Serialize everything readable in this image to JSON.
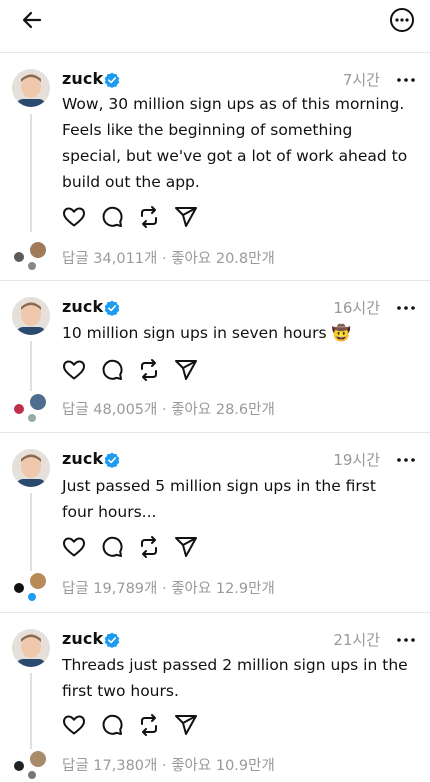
{
  "topbar": {
    "back_icon": "arrow-left-icon",
    "more_icon": "more-circle-icon"
  },
  "posts": [
    {
      "username": "zuck",
      "time": "7시간",
      "text": "Wow, 30 million sign ups as of this morning. Feels like the beginning of something special, but we've got a lot of work ahead to build out the app.",
      "replies_label": "답글",
      "replies": "34,011개",
      "separator": "·",
      "likes_label": "좋아요",
      "likes": "20.8만개"
    },
    {
      "username": "zuck",
      "time": "16시간",
      "text": "10 million sign ups in seven hours 🤠",
      "replies_label": "답글",
      "replies": "48,005개",
      "separator": "·",
      "likes_label": "좋아요",
      "likes": "28.6만개"
    },
    {
      "username": "zuck",
      "time": "19시간",
      "text": "Just passed 5 million sign ups in the first four hours...",
      "replies_label": "답글",
      "replies": "19,789개",
      "separator": "·",
      "likes_label": "좋아요",
      "likes": "12.9만개"
    },
    {
      "username": "zuck",
      "time": "21시간",
      "text": "Threads just passed 2 million sign ups in the first two hours.",
      "replies_label": "답글",
      "replies": "17,380개",
      "separator": "·",
      "likes_label": "좋아요",
      "likes": "10.9만개"
    }
  ],
  "icons": {
    "like": "heart-icon",
    "reply": "reply-icon",
    "repost": "repost-icon",
    "share": "send-icon",
    "verified": "verified-badge-icon"
  },
  "colors": {
    "verified": "#1d9bf0",
    "muted": "#999999",
    "divider": "#e6e6e6"
  }
}
